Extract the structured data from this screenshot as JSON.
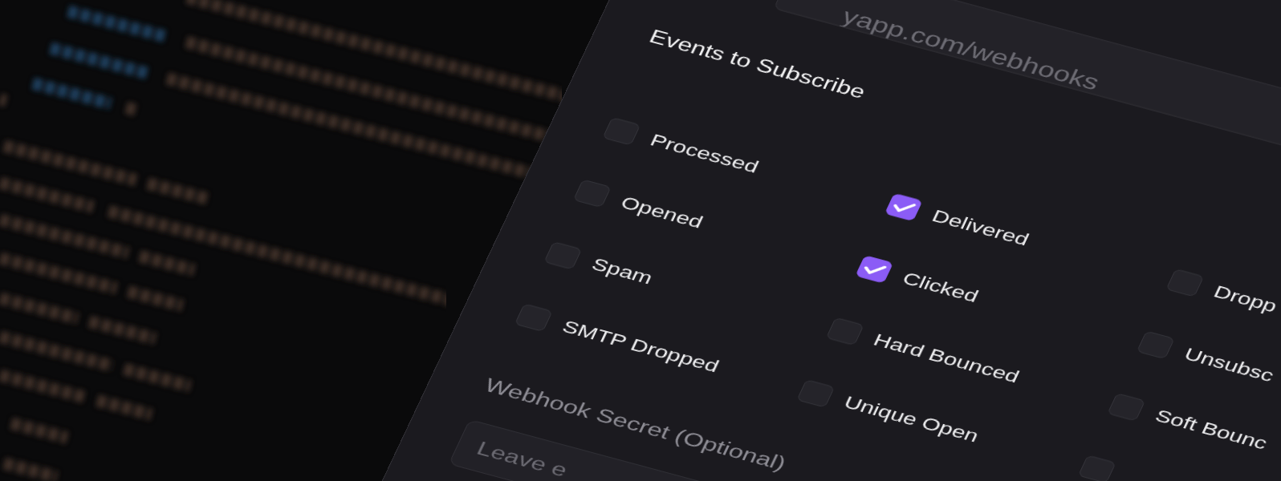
{
  "url_field": {
    "placeholder": "yapp.com/webhooks"
  },
  "events_section": {
    "title": "Events to Subscribe",
    "events": [
      {
        "label": "Processed",
        "checked": false
      },
      {
        "label": "Delivered",
        "checked": true
      },
      {
        "label": "Dropp",
        "checked": false
      },
      {
        "label": "Opened",
        "checked": false
      },
      {
        "label": "Clicked",
        "checked": true
      },
      {
        "label": "Unsubsc",
        "checked": false
      },
      {
        "label": "Spam",
        "checked": false
      },
      {
        "label": "Hard Bounced",
        "checked": false
      },
      {
        "label": "Soft Bounc",
        "checked": false
      },
      {
        "label": "SMTP Dropped",
        "checked": false
      },
      {
        "label": "Unique Open",
        "checked": false
      },
      {
        "checked": false
      }
    ]
  },
  "secret_field": {
    "label": "Webhook Secret (Optional)",
    "placeholder": "Leave e"
  }
}
